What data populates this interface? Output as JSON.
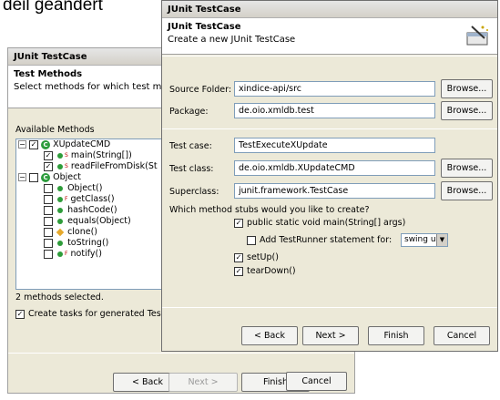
{
  "background_text": "deil geändert",
  "back_dialog": {
    "title": "JUnit TestCase",
    "banner_title": "Test Methods",
    "banner_desc": "Select methods for which test metho",
    "available_label": "Available Methods",
    "tree": [
      {
        "text": "XUpdateCMD",
        "checked": true
      },
      {
        "text": "main(String[])",
        "checked": true
      },
      {
        "text": "readFileFromDisk(St",
        "checked": true
      },
      {
        "text": "Object",
        "checked": false
      },
      {
        "text": "Object()",
        "checked": false
      },
      {
        "text": "getClass()",
        "checked": false
      },
      {
        "text": "hashCode()",
        "checked": false
      },
      {
        "text": "equals(Object)",
        "checked": false
      },
      {
        "text": "clone()",
        "checked": false
      },
      {
        "text": "toString()",
        "checked": false
      },
      {
        "text": "notify()",
        "checked": false
      }
    ],
    "status": "2 methods selected.",
    "create_tasks": "Create tasks for generated Test r",
    "buttons": {
      "back": "< Back",
      "next": "Next >",
      "finish": "Finish",
      "cancel": "Cancel"
    }
  },
  "front_dialog": {
    "title": "JUnit TestCase",
    "banner_title": "JUnit TestCase",
    "banner_desc": "Create a new JUnit TestCase",
    "source_folder_label": "Source Folder:",
    "source_folder_value": "xindice-api/src",
    "package_label": "Package:",
    "package_value": "de.oio.xmldb.test",
    "test_case_label": "Test case:",
    "test_case_value": "TestExecuteXUpdate",
    "test_class_label": "Test class:",
    "test_class_value": "de.oio.xmldb.XUpdateCMD",
    "superclass_label": "Superclass:",
    "superclass_value": "junit.framework.TestCase",
    "browse": "Browse...",
    "stubs_question": "Which method stubs would you like to create?",
    "stub_main": "public static void main(String[] args)",
    "stub_testrunner": "Add TestRunner statement for:",
    "testrunner_select": "swing ui",
    "stub_setup": "setUp()",
    "stub_teardown": "tearDown()",
    "buttons": {
      "back": "< Back",
      "next": "Next >",
      "finish": "Finish",
      "cancel": "Cancel"
    }
  }
}
